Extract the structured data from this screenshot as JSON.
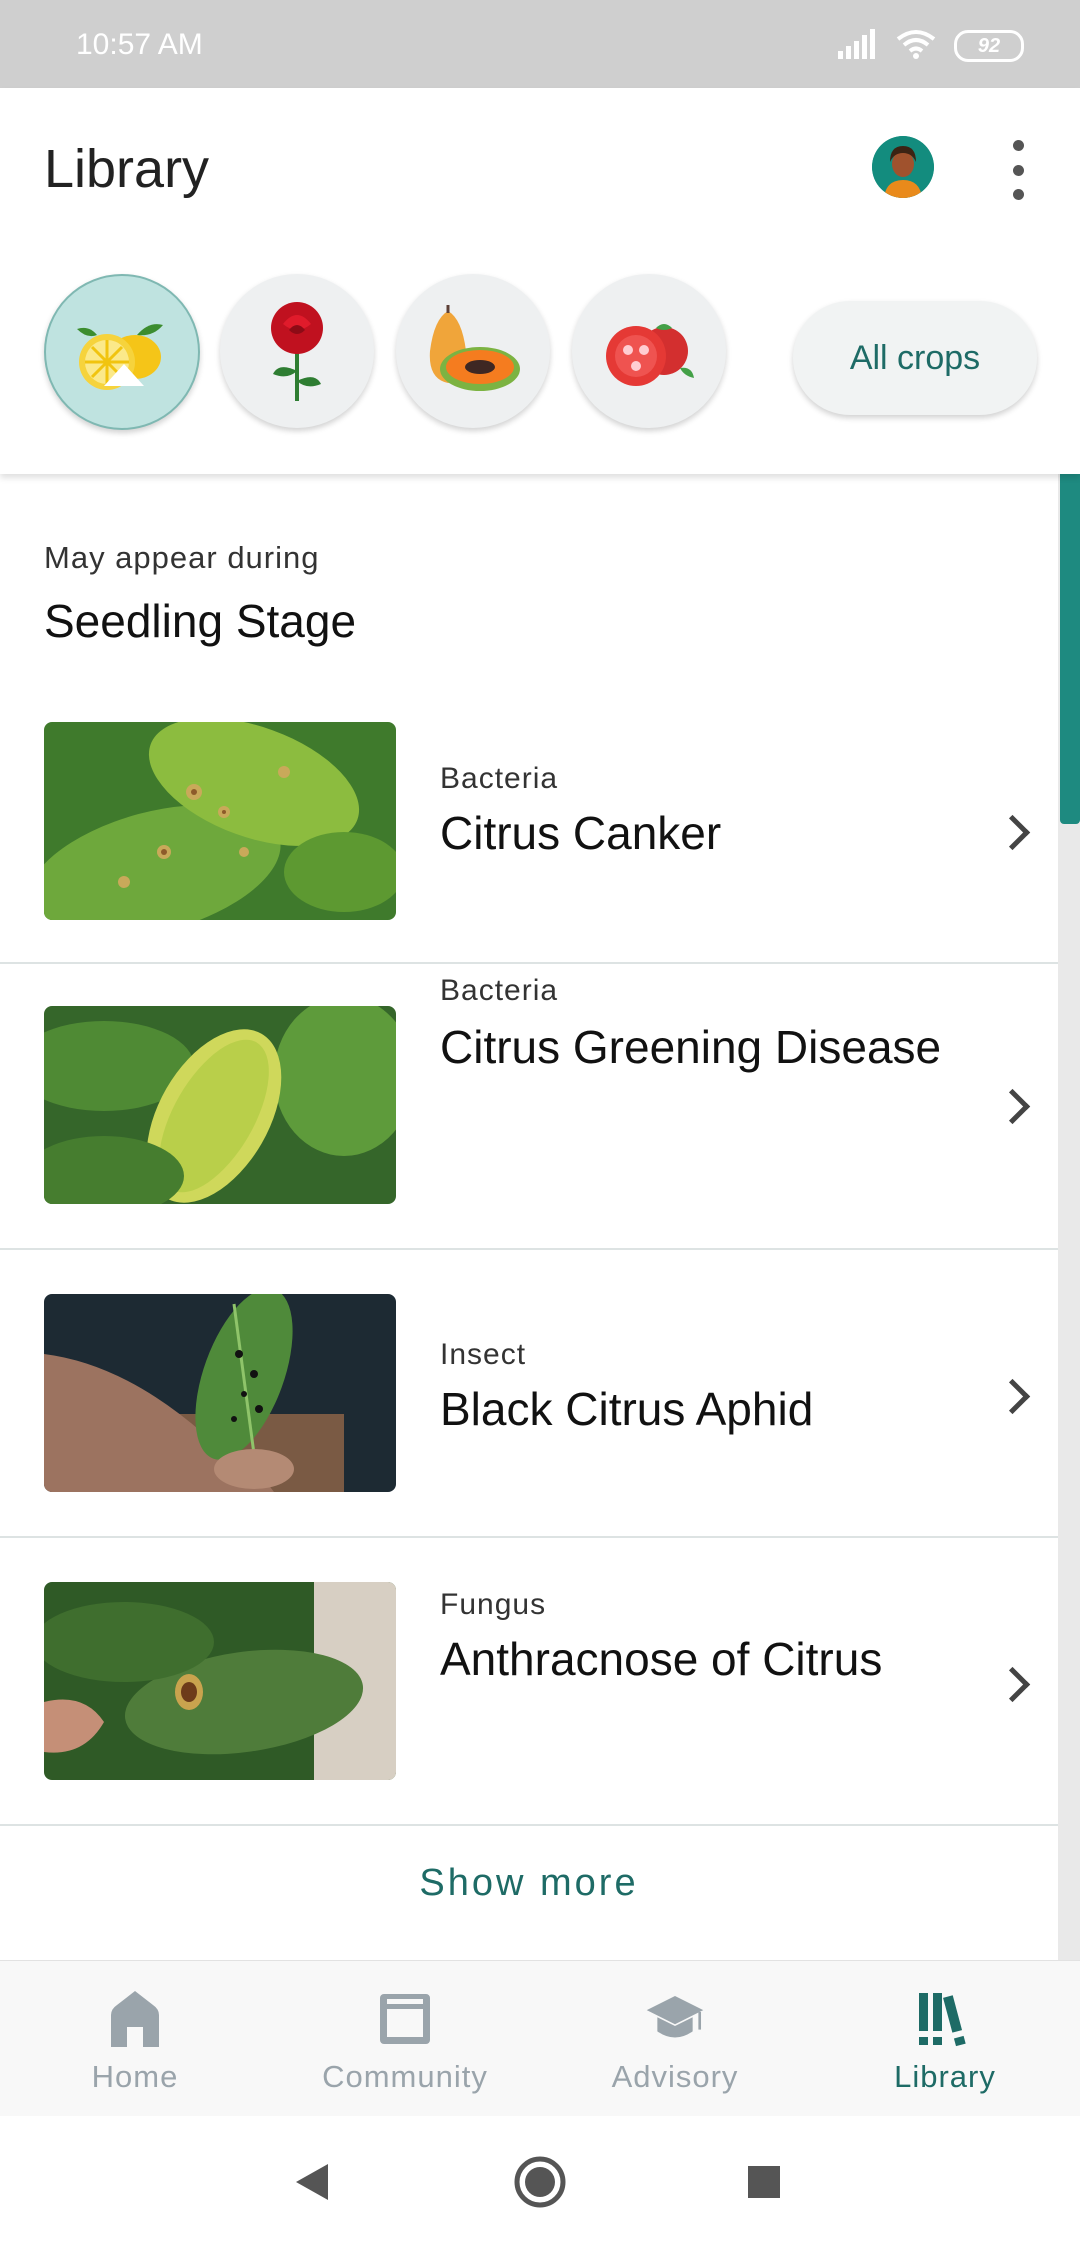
{
  "status_bar": {
    "time": "10:57 AM",
    "battery": "92"
  },
  "header": {
    "title": "Library",
    "crops": [
      {
        "name": "citrus",
        "icon": "lemon-icon",
        "selected": true
      },
      {
        "name": "rose",
        "icon": "rose-icon",
        "selected": false
      },
      {
        "name": "papaya",
        "icon": "papaya-icon",
        "selected": false
      },
      {
        "name": "tomato",
        "icon": "tomato-icon",
        "selected": false
      }
    ],
    "all_crops_label": "All crops"
  },
  "section": {
    "caption": "May appear during",
    "title": "Seedling Stage"
  },
  "items": [
    {
      "type": "Bacteria",
      "name": "Citrus Canker"
    },
    {
      "type": "Bacteria",
      "name": "Citrus Greening Disease"
    },
    {
      "type": "Insect",
      "name": "Black Citrus Aphid"
    },
    {
      "type": "Fungus",
      "name": "Anthracnose of Citrus"
    }
  ],
  "show_more_label": "Show more",
  "bottom_nav": [
    {
      "label": "Home",
      "icon": "home-icon",
      "active": false
    },
    {
      "label": "Community",
      "icon": "community-icon",
      "active": false
    },
    {
      "label": "Advisory",
      "icon": "graduation-cap-icon",
      "active": false
    },
    {
      "label": "Library",
      "icon": "books-icon",
      "active": true
    }
  ],
  "colors": {
    "accent": "#1e6b66",
    "scroll_thumb": "#1e8a80",
    "status_bar": "#cfcfcf"
  }
}
